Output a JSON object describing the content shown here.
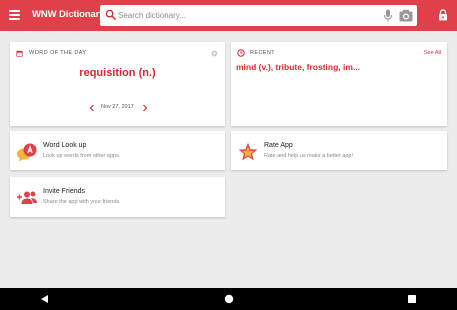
{
  "app": {
    "title": "WNW Dictionary",
    "accent_color": "#e0404a",
    "word_color": "#d32a34"
  },
  "header": {
    "menu_icon": "hamburger-menu-icon",
    "search": {
      "placeholder": "Search dictionary..."
    },
    "mic_icon": "microphone-icon",
    "camera_icon": "camera-icon",
    "lock_icon": "lock-icon"
  },
  "word_of_the_day": {
    "label": "WORD OF THE DAY",
    "word": "requisition (n.)",
    "date": "Nov 27, 2017"
  },
  "recent": {
    "label": "RECENT",
    "see_all": "See All",
    "words": "mind (v.), tribute, frosting, im..."
  },
  "features": {
    "lookup": {
      "title": "Word Look up",
      "subtitle": "Look up words from other apps."
    },
    "rate": {
      "title": "Rate App",
      "subtitle": "Rate and help us make a better app!"
    },
    "invite": {
      "title": "Invite Friends",
      "subtitle": "Share the app with your friends."
    }
  },
  "system_nav": {
    "back_icon": "back-triangle-icon",
    "home_icon": "home-circle-icon",
    "recents_icon": "recents-square-icon"
  }
}
